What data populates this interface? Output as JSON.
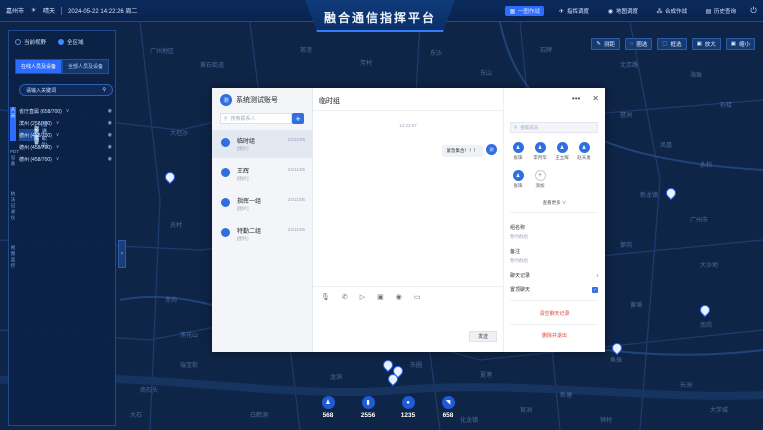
{
  "header": {
    "city": "嘉州市",
    "weather": "晴天",
    "datetime": "2024-05-22 14:22:26 周二",
    "title": "融合通信指挥平台",
    "nav": [
      {
        "label": "一图作战",
        "icon": "map-grid-icon",
        "active": true
      },
      {
        "label": "指挥调度",
        "icon": "dispatch-icon",
        "active": false
      },
      {
        "label": "地图调度",
        "icon": "map-pin-icon",
        "active": false
      },
      {
        "label": "合成作战",
        "icon": "team-icon",
        "active": false
      },
      {
        "label": "历史查询",
        "icon": "history-icon",
        "active": false
      }
    ],
    "power_icon": "power-icon"
  },
  "map_tools": [
    {
      "label": "测距",
      "icon": "ruler-icon"
    },
    {
      "label": "圈选",
      "icon": "circle-select-icon"
    },
    {
      "label": "框选",
      "icon": "box-select-icon"
    },
    {
      "label": "放大",
      "icon": "zoom-in-icon"
    },
    {
      "label": "缩小",
      "icon": "zoom-out-icon"
    }
  ],
  "left_panel": {
    "scope": {
      "current_view": "当前视野",
      "all_area": "全区域"
    },
    "tabs": [
      "在线人员及设备",
      "全部人员及设备"
    ],
    "search_placeholder": "请输入关键词",
    "side_labels": [
      "人员",
      "PDT设备",
      "执法记录仪",
      "视频监控"
    ],
    "tree": [
      {
        "type": "group",
        "label": "省厅直属 (658/700)"
      },
      {
        "type": "group",
        "label": "滨州 (258/700)"
      },
      {
        "type": "member",
        "name": "张天华",
        "role": "(普通职员)"
      },
      {
        "type": "member",
        "name": "刘子睿",
        "role": "(普通职员)",
        "selected": true
      },
      {
        "type": "member",
        "name": "王强",
        "role": "(普通职员)"
      },
      {
        "type": "member",
        "name": "李三",
        "role": "(普通职员)"
      },
      {
        "type": "member",
        "name": "赵辉",
        "role": "(普通职员)"
      },
      {
        "type": "group",
        "label": "德州 (458/700)"
      },
      {
        "type": "group",
        "label": "德州 (458/700)"
      },
      {
        "type": "group",
        "label": "德州 (458/700)"
      }
    ]
  },
  "map_labels": [
    "广州地区",
    "黄石街道",
    "大坦沙",
    "员村",
    "赤岗",
    "瑞宝街",
    "南石头",
    "白鹤洞",
    "茶滘",
    "芳村",
    "东沙",
    "东山",
    "石牌",
    "北京路",
    "海珠",
    "琶洲",
    "凤凰",
    "永和",
    "新龙镇",
    "广州市",
    "萝岗",
    "大沙地",
    "黄埔",
    "南岗",
    "鱼珠",
    "长洲",
    "新塘",
    "夏港",
    "龙洞",
    "东圃",
    "官洲",
    "大石",
    "钟村",
    "大学城",
    "化龙镇",
    "石楼",
    "莲花山"
  ],
  "stats": [
    {
      "icon": "person-icon",
      "value": "568"
    },
    {
      "icon": "walkie-talkie-icon",
      "value": "2556"
    },
    {
      "icon": "body-cam-icon",
      "value": "1235"
    },
    {
      "icon": "camera-icon",
      "value": "658"
    }
  ],
  "chat": {
    "account": {
      "avatar_text": "测",
      "name": "系统测试账号"
    },
    "search_placeholder": "搜索联系人",
    "add_button": "+",
    "conversations": [
      {
        "name": "临时组",
        "date": "22/11/05",
        "sub": "[图片]",
        "active": true
      },
      {
        "name": "王辉",
        "date": "22/11/05",
        "sub": "[图片]",
        "active": false
      },
      {
        "name": "指挥一组",
        "date": "22/11/05",
        "sub": "[图片]",
        "active": false
      },
      {
        "name": "特勤二组",
        "date": "22/11/05",
        "sub": "[图片]",
        "active": false
      }
    ],
    "title": "临时组",
    "message_time": "14:22:07",
    "message_text": "紧急集合！！！",
    "message_avatar": "测",
    "composer_icons": [
      "microphone-icon",
      "phone-icon",
      "video-icon",
      "image-icon",
      "location-icon",
      "screen-icon"
    ],
    "send_label": "发送",
    "more_icon": "•••",
    "close_icon": "✕",
    "member_search_placeholder": "搜索成员",
    "members": [
      {
        "name": "张珠"
      },
      {
        "name": "李月华"
      },
      {
        "name": "王立辉"
      },
      {
        "name": "赵天发"
      },
      {
        "name": "张珠"
      }
    ],
    "add_member_label": "添加",
    "show_more": "查看更多 ∨",
    "group_name_label": "组名称",
    "group_name_value": "暂时群组",
    "remark_label": "备注",
    "remark_value": "暂时群组",
    "chat_history": "聊天记录",
    "pin_chat": "置顶聊天",
    "pin_checked": true,
    "clear_history": "清空聊天记录",
    "delete_exit": "删除并退出"
  },
  "colors": {
    "accent": "#2e6bff",
    "danger": "#e0443a",
    "panel": "#0b2146"
  }
}
